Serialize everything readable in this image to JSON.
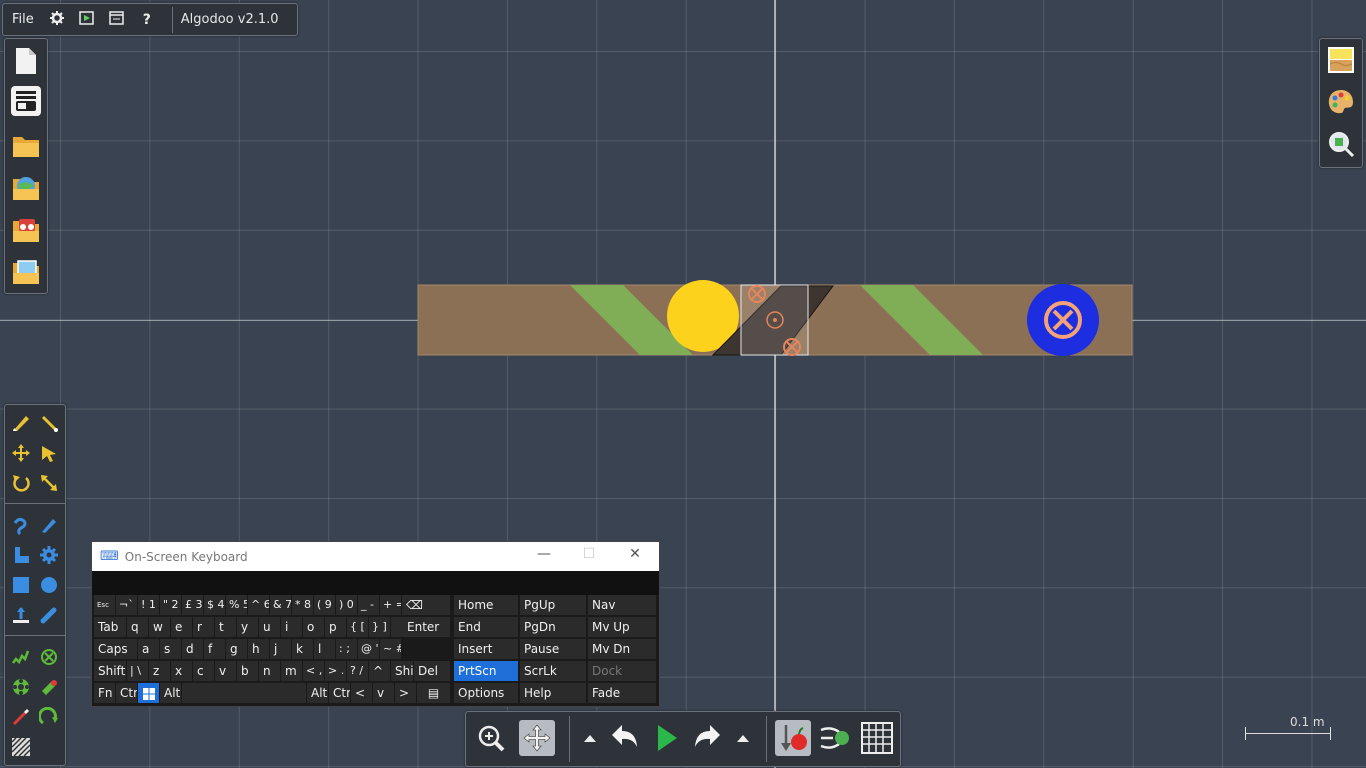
{
  "menubar": {
    "file_label": "File",
    "app_title": "Algodoo v2.1.0",
    "icons": [
      "gear-icon",
      "play-scene-icon",
      "window-icon",
      "help-icon"
    ],
    "help_glyph": "?"
  },
  "file_panel": {
    "icons": [
      "new-scene-icon",
      "scene-list-icon",
      "open-folder-icon",
      "open-online-icon",
      "open-demo-icon",
      "open-image-icon"
    ]
  },
  "right_panel": {
    "icons": [
      "background-icon",
      "palette-icon",
      "zoom-find-icon"
    ]
  },
  "tools": {
    "icons": [
      "sketch-tool-icon",
      "brush-tool-icon",
      "move-tool-icon",
      "drag-tool-icon",
      "rotate-tool-icon",
      "scale-tool-icon",
      "rope-tool-icon",
      "knife-tool-icon",
      "plane-tool-icon",
      "gear-tool-icon",
      "box-tool-icon",
      "circle-tool-icon",
      "fixate-tool-icon",
      "tracer-tool-icon",
      "spring-tool-icon",
      "axle-tool-icon",
      "thruster-tool-icon",
      "laser-tool-icon",
      "pen-tool-icon",
      "chain-tool-icon",
      "texture-tool-icon"
    ]
  },
  "osk": {
    "title": "On-Screen Keyboard",
    "accent": "#1e6fd9",
    "rows": [
      [
        "Esc",
        "¬`",
        "! 1",
        "\" 2",
        "£ 3",
        "$ 4",
        "% 5",
        "^ 6",
        "& 7",
        "* 8",
        "( 9",
        ") 0",
        "_ -",
        "+ =",
        "⌫"
      ],
      [
        "Tab",
        "q",
        "w",
        "e",
        "r",
        "t",
        "y",
        "u",
        "i",
        "o",
        "p",
        "{ [",
        "} ]",
        "Enter"
      ],
      [
        "Caps",
        "a",
        "s",
        "d",
        "f",
        "g",
        "h",
        "j",
        "k",
        "l",
        ": ;",
        "@ '",
        "~ #"
      ],
      [
        "Shift",
        "| \\",
        "z",
        "x",
        "c",
        "v",
        "b",
        "n",
        "m",
        "< ,",
        "> .",
        "? /",
        "^",
        "Shift",
        "Del"
      ],
      [
        "Fn",
        "Ctrl",
        "Win",
        "Alt",
        "",
        "Alt",
        "Ctrl",
        "<",
        "v",
        ">",
        "▤"
      ]
    ],
    "nav_keys": [
      [
        "Home",
        "PgUp",
        "Nav"
      ],
      [
        "End",
        "PgDn",
        "Mv Up"
      ],
      [
        "Insert",
        "Pause",
        "Mv Dn"
      ],
      [
        "PrtScn",
        "ScrLk",
        "Dock"
      ],
      [
        "Options",
        "Help",
        "Fade"
      ]
    ]
  },
  "bottom_toolbar": {
    "icons": [
      "zoom-icon",
      "pan-icon",
      "menu-up-icon",
      "undo-icon",
      "play-icon",
      "redo-icon",
      "menu-up-icon",
      "gravity-icon",
      "air-friction-icon",
      "grid-icon"
    ]
  },
  "scale": {
    "label": "0.1 m"
  },
  "colors": {
    "background": "#3a4351",
    "plank": "#8c7056",
    "stripe": "#7fae57",
    "yellow_ball": "#fcd21c",
    "blue_ball": "#1d2de0",
    "hinge": "#e6845a"
  }
}
